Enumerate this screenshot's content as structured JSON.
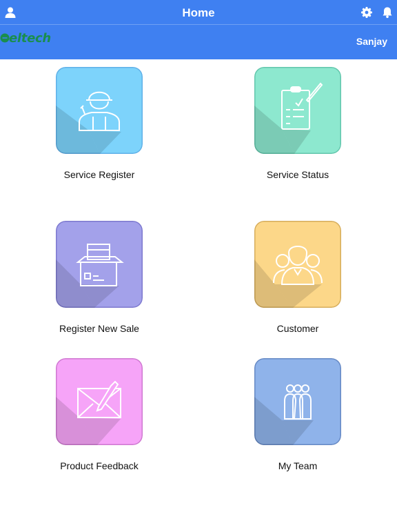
{
  "header": {
    "title": "Home",
    "username": "Sanjay",
    "logo_text": "eltech",
    "icons": [
      "user-icon",
      "gear-icon",
      "bell-icon"
    ],
    "bar_color": "#3f80f1"
  },
  "tiles": [
    {
      "label": "Service Register",
      "icon": "technician-icon",
      "color": "#7dd3fb",
      "border": "#5fb0e8"
    },
    {
      "label": "Service Status",
      "icon": "clipboard-checklist-icon",
      "color": "#8de8cf",
      "border": "#62c6ac"
    },
    {
      "label": "Register New Sale",
      "icon": "open-box-icon",
      "color": "#a3a1ea",
      "border": "#7d79cf"
    },
    {
      "label": "Customer",
      "icon": "customers-group-icon",
      "color": "#fcd789",
      "border": "#d6ad5c"
    },
    {
      "label": "Product Feedback",
      "icon": "envelope-pen-icon",
      "color": "#f6a4f8",
      "border": "#cf79d1"
    },
    {
      "label": "My Team",
      "icon": "team-icon",
      "color": "#8fb3ea",
      "border": "#6689c4"
    }
  ]
}
